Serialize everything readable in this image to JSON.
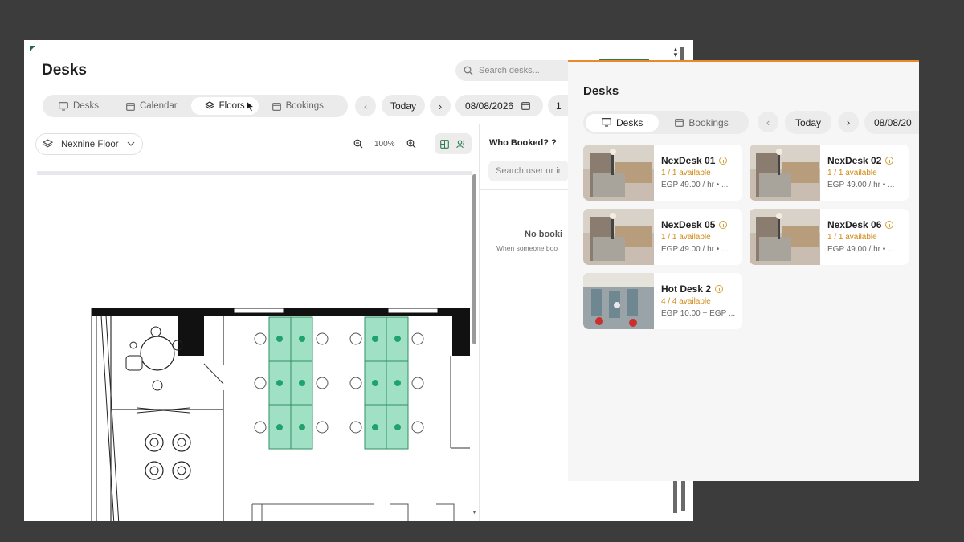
{
  "main": {
    "title": "Desks",
    "search_placeholder": "Search desks...",
    "tabs": [
      {
        "label": "Desks",
        "icon": "monitor-icon"
      },
      {
        "label": "Calendar",
        "icon": "calendar-icon"
      },
      {
        "label": "Floors",
        "icon": "layers-icon",
        "active": true
      },
      {
        "label": "Bookings",
        "icon": "calendar-icon"
      }
    ],
    "today_label": "Today",
    "date_value": "08/08/2026",
    "extra_pill": "1",
    "floor_select": "Nexnine Floor",
    "zoom_level": "100%",
    "who_booked": "Who Booked? ?",
    "user_search_placeholder": "Search user or in",
    "no_bookings": "No booki",
    "when_someone": "When someone boo"
  },
  "side": {
    "title": "Desks",
    "tabs": [
      {
        "label": "Desks",
        "icon": "monitor-icon",
        "active": true
      },
      {
        "label": "Bookings",
        "icon": "calendar-icon"
      }
    ],
    "today_label": "Today",
    "date_value": "08/08/20",
    "cards": [
      {
        "name": "NexDesk 01",
        "availability": "1 / 1 available",
        "price": "EGP 49.00 / hr • ...",
        "image": "desk-pod"
      },
      {
        "name": "NexDesk 02",
        "availability": "1 / 1 available",
        "price": "EGP 49.00 / hr • ...",
        "image": "desk-pod"
      },
      {
        "name": "NexDesk 05",
        "availability": "1 / 1 available",
        "price": "EGP 49.00 / hr • ...",
        "image": "desk-pod"
      },
      {
        "name": "NexDesk 06",
        "availability": "1 / 1 available",
        "price": "EGP 49.00 / hr • ...",
        "image": "desk-pod"
      },
      {
        "name": "Hot Desk 2",
        "availability": "4 / 4 available",
        "price": "EGP 10.00 + EGP ...",
        "image": "office-aerial"
      }
    ]
  },
  "colors": {
    "accent_green": "#2f7a4f",
    "desk_green": "#7ed1ae",
    "available_orange": "#d18a16",
    "window_top_accent": "#e8892b"
  }
}
